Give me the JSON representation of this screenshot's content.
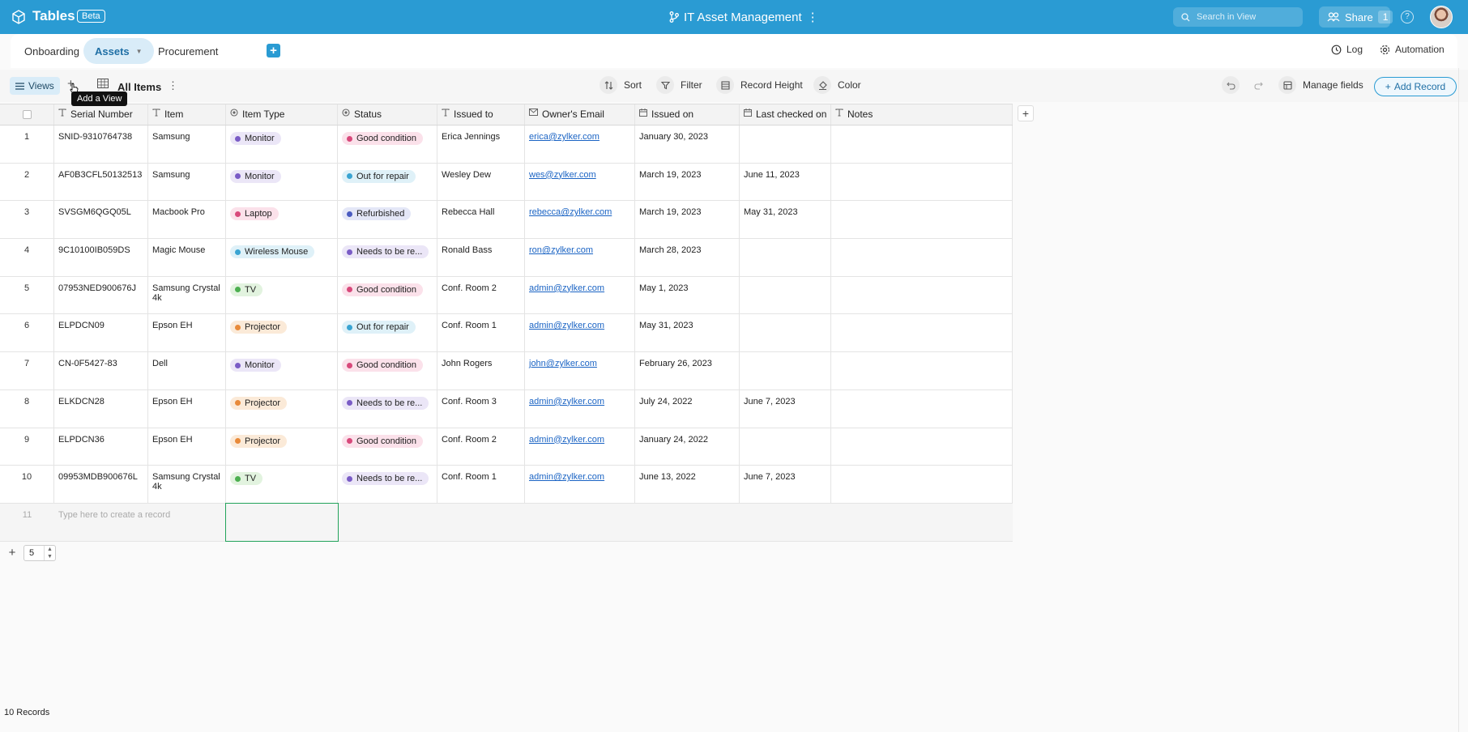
{
  "topbar": {
    "app_name": "Tables",
    "beta_label": "Beta",
    "base_name": "IT Asset Management",
    "search_placeholder": "Search in View",
    "share_label": "Share",
    "share_count": "1",
    "help_glyph": "?"
  },
  "tabs": {
    "items": [
      {
        "label": "Onboarding"
      },
      {
        "label": "Assets"
      },
      {
        "label": "Procurement"
      }
    ],
    "add_glyph": "+",
    "log_label": "Log",
    "automation_label": "Automation"
  },
  "toolbar": {
    "views_label": "Views",
    "add_glyph": "+",
    "tooltip": "Add a View",
    "view_name": "All Items",
    "more_glyph": "⋮",
    "sort_label": "Sort",
    "filter_label": "Filter",
    "record_height_label": "Record Height",
    "color_label": "Color",
    "manage_fields_label": "Manage fields",
    "add_record_label": "Add Record"
  },
  "columns": [
    "Serial Number",
    "Item",
    "Item Type",
    "Status",
    "Issued to",
    "Owner's Email",
    "Issued on",
    "Last checked on",
    "Notes"
  ],
  "rows": [
    {
      "n": "1",
      "serial": "SNID-9310764738",
      "item": "Samsung",
      "type": "Monitor",
      "status": "Good condition",
      "issued_to": "Erica Jennings",
      "email": "erica@zylker.com",
      "issued_on": "January 30, 2023",
      "last_checked": ""
    },
    {
      "n": "2",
      "serial": "AF0B3CFL50132513",
      "item": "Samsung",
      "type": "Monitor",
      "status": "Out for repair",
      "issued_to": "Wesley Dew",
      "email": "wes@zylker.com",
      "issued_on": "March 19, 2023",
      "last_checked": "June 11, 2023"
    },
    {
      "n": "3",
      "serial": "SVSGM6QGQ05L",
      "item": "Macbook Pro",
      "type": "Laptop",
      "status": "Refurbished",
      "issued_to": "Rebecca Hall",
      "email": "rebecca@zylker.com",
      "issued_on": "March 19, 2023",
      "last_checked": "May 31, 2023"
    },
    {
      "n": "4",
      "serial": "9C10100IB059DS",
      "item": "Magic Mouse",
      "type": "Wireless Mouse",
      "status": "Needs to be re...",
      "issued_to": "Ronald Bass",
      "email": "ron@zylker.com",
      "issued_on": "March 28, 2023",
      "last_checked": ""
    },
    {
      "n": "5",
      "serial": "07953NED900676J",
      "item": "Samsung Crystal 4k",
      "type": "TV",
      "status": "Good condition",
      "issued_to": "Conf. Room 2",
      "email": "admin@zylker.com",
      "issued_on": "May 1, 2023",
      "last_checked": ""
    },
    {
      "n": "6",
      "serial": "ELPDCN09",
      "item": "Epson EH",
      "type": "Projector",
      "status": "Out for repair",
      "issued_to": "Conf. Room 1",
      "email": "admin@zylker.com",
      "issued_on": "May 31, 2023",
      "last_checked": ""
    },
    {
      "n": "7",
      "serial": "CN-0F5427-83",
      "item": "Dell",
      "type": "Monitor",
      "status": "Good condition",
      "issued_to": "John Rogers",
      "email": "john@zylker.com",
      "issued_on": "February 26, 2023",
      "last_checked": ""
    },
    {
      "n": "8",
      "serial": "ELKDCN28",
      "item": "Epson EH",
      "type": "Projector",
      "status": "Needs to be re...",
      "issued_to": "Conf. Room 3",
      "email": "admin@zylker.com",
      "issued_on": "July 24, 2022",
      "last_checked": "June 7, 2023"
    },
    {
      "n": "9",
      "serial": "ELPDCN36",
      "item": "Epson EH",
      "type": "Projector",
      "status": "Good condition",
      "issued_to": "Conf. Room 2",
      "email": "admin@zylker.com",
      "issued_on": "January 24, 2022",
      "last_checked": ""
    },
    {
      "n": "10",
      "serial": "09953MDB900676L",
      "item": "Samsung Crystal 4k",
      "type": "TV",
      "status": "Needs to be re...",
      "issued_to": "Conf. Room 1",
      "email": "admin@zylker.com",
      "issued_on": "June 13, 2022",
      "last_checked": "June 7, 2023"
    }
  ],
  "type_styles": {
    "Monitor": {
      "bg": "#ebe6f7",
      "dot": "#7a5cc6"
    },
    "Laptop": {
      "bg": "#fbe1ea",
      "dot": "#d8497b"
    },
    "Wireless Mouse": {
      "bg": "#dff1f8",
      "dot": "#3aa4d2"
    },
    "TV": {
      "bg": "#e2f3df",
      "dot": "#4caf50"
    },
    "Projector": {
      "bg": "#fbead8",
      "dot": "#e88a3a"
    }
  },
  "status_styles": {
    "Good condition": {
      "bg": "#fbe1ea",
      "dot": "#d8497b"
    },
    "Out for repair": {
      "bg": "#dff1f8",
      "dot": "#3aa4d2"
    },
    "Refurbished": {
      "bg": "#e4e7f7",
      "dot": "#4a5bc0"
    },
    "Needs to be re...": {
      "bg": "#ebe6f7",
      "dot": "#7a5cc6"
    }
  },
  "new_row": {
    "number": "11",
    "placeholder": "Type here to create a record"
  },
  "pager": {
    "add_glyph": "+",
    "page_size": "5"
  },
  "footer": {
    "record_count": "10 Records"
  },
  "colors": {
    "brand": "#2a9bd3",
    "selection": "#22a35a",
    "link": "#1b64c4"
  }
}
